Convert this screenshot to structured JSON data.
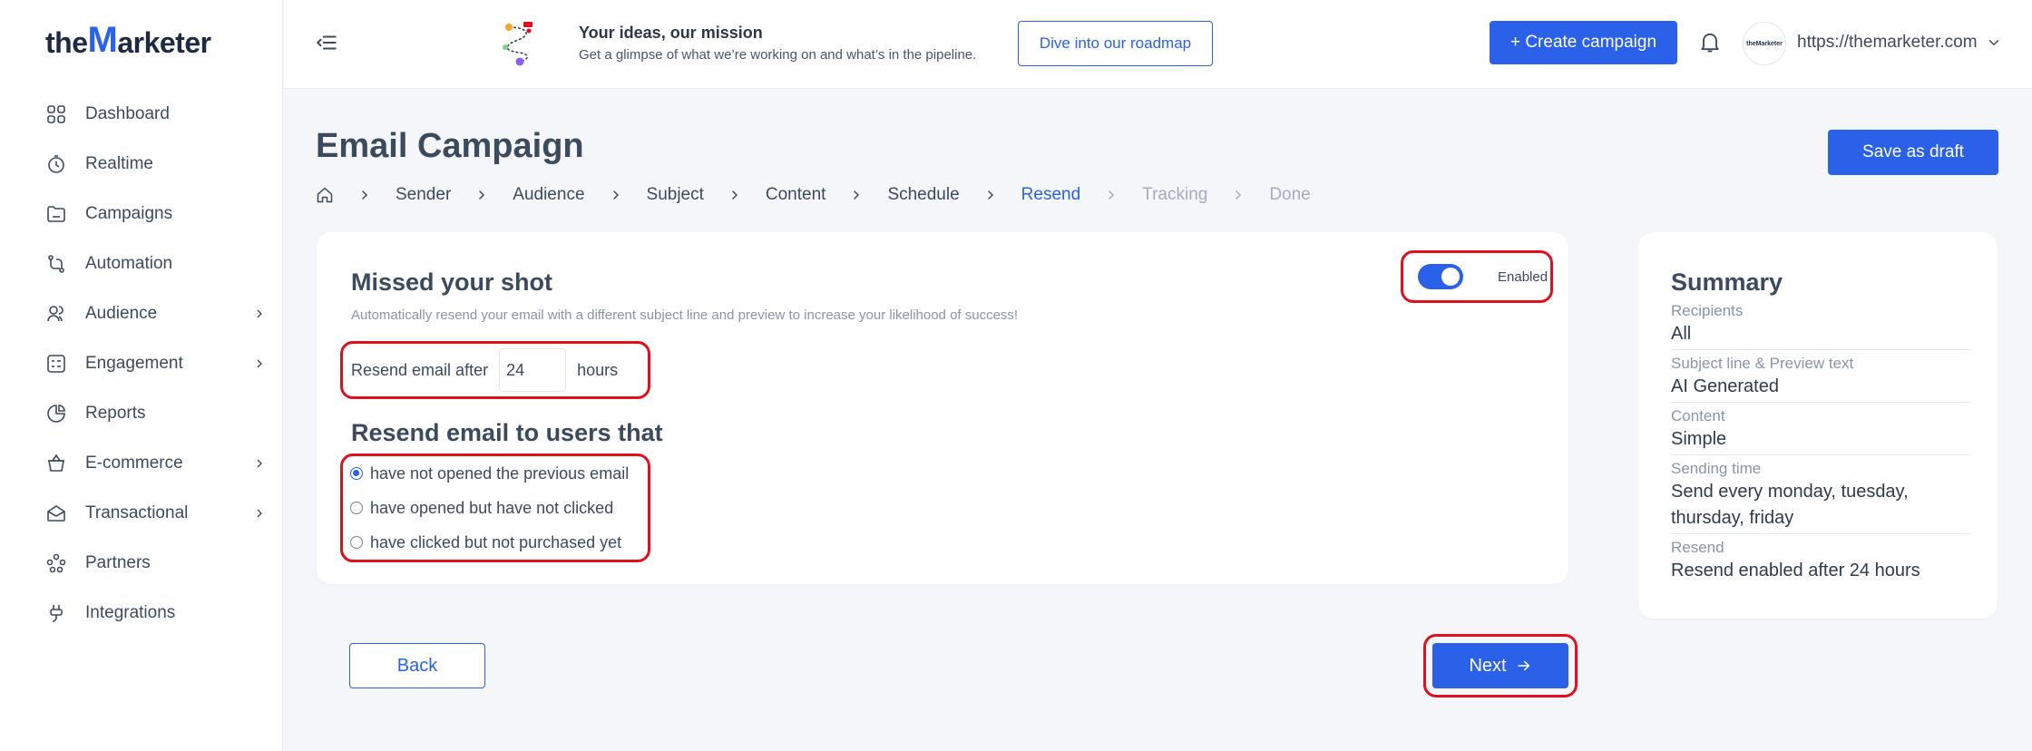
{
  "brand": {
    "logo_pre": "the",
    "logo_m": "M",
    "logo_post": "arketer",
    "accent": "#2a61e8",
    "highlight": "#e0101e"
  },
  "sidebar": {
    "items": [
      {
        "label": "Dashboard",
        "icon": "dashboard-icon",
        "has_children": false
      },
      {
        "label": "Realtime",
        "icon": "realtime-icon",
        "has_children": false
      },
      {
        "label": "Campaigns",
        "icon": "campaigns-icon",
        "has_children": false
      },
      {
        "label": "Automation",
        "icon": "automation-icon",
        "has_children": false
      },
      {
        "label": "Audience",
        "icon": "audience-icon",
        "has_children": true
      },
      {
        "label": "Engagement",
        "icon": "engagement-icon",
        "has_children": true
      },
      {
        "label": "Reports",
        "icon": "reports-icon",
        "has_children": false
      },
      {
        "label": "E-commerce",
        "icon": "ecommerce-icon",
        "has_children": true
      },
      {
        "label": "Transactional",
        "icon": "transactional-icon",
        "has_children": true
      },
      {
        "label": "Partners",
        "icon": "partners-icon",
        "has_children": false
      },
      {
        "label": "Integrations",
        "icon": "integrations-icon",
        "has_children": false
      }
    ]
  },
  "topbar": {
    "roadmap_title": "Your ideas, our mission",
    "roadmap_sub": "Get a glimpse of what we’re working on and what’s in the pipeline.",
    "roadmap_button": "Dive into our roadmap",
    "create_button": "+ Create campaign",
    "avatar_text": "theMarketer",
    "site_url": "https://themarketer.com"
  },
  "page": {
    "title": "Email Campaign",
    "save_draft": "Save as draft",
    "breadcrumb": [
      {
        "label": "Sender",
        "state": "done"
      },
      {
        "label": "Audience",
        "state": "done"
      },
      {
        "label": "Subject",
        "state": "done"
      },
      {
        "label": "Content",
        "state": "done"
      },
      {
        "label": "Schedule",
        "state": "done"
      },
      {
        "label": "Resend",
        "state": "active"
      },
      {
        "label": "Tracking",
        "state": "future"
      },
      {
        "label": "Done",
        "state": "future"
      }
    ]
  },
  "resend": {
    "title": "Missed your shot",
    "description": "Automatically resend your email with a different subject line and preview to increase your likelihood of success!",
    "toggle_label": "Enabled",
    "toggle_on": true,
    "after_prefix": "Resend email after",
    "after_value": "24",
    "after_suffix": "hours",
    "users_title": "Resend email to users that",
    "options": [
      {
        "label": "have not opened the previous email",
        "checked": true
      },
      {
        "label": "have opened but have not clicked",
        "checked": false
      },
      {
        "label": "have clicked but not purchased yet",
        "checked": false
      }
    ]
  },
  "nav_buttons": {
    "back": "Back",
    "next": "Next"
  },
  "summary": {
    "title": "Summary",
    "rows": [
      {
        "label": "Recipients",
        "value": "All"
      },
      {
        "label": "Subject line & Preview text",
        "value": "AI Generated"
      },
      {
        "label": "Content",
        "value": "Simple"
      },
      {
        "label": "Sending time",
        "value": "Send every monday, tuesday, thursday, friday"
      },
      {
        "label": "Resend",
        "value": "Resend enabled after 24 hours"
      }
    ]
  }
}
